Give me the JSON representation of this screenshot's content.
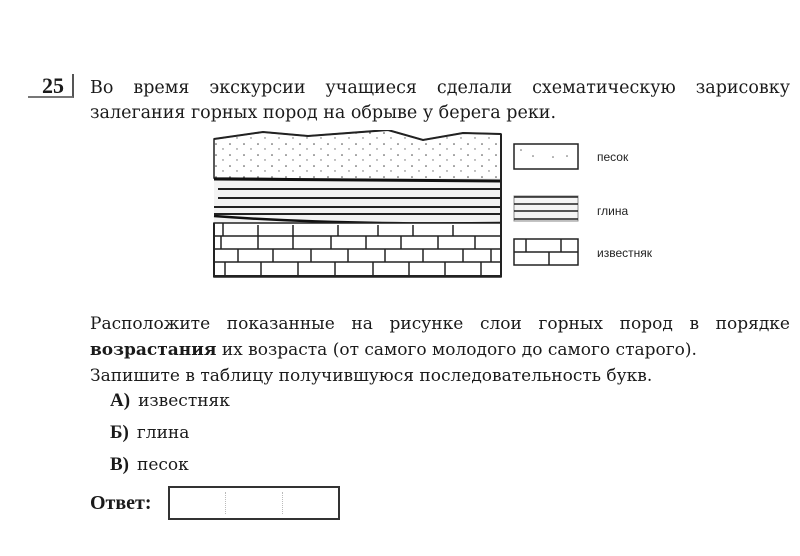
{
  "task": {
    "number": "25",
    "intro_line1": "Во время экскурсии учащиеся сделали схематическую зарисовку",
    "intro_line2": "залегания горных пород на обрыве у берега реки.",
    "instruction_line1": "Расположите показанные на рисунке слои горных пород в порядке",
    "instruction_bold": "возрастания",
    "instruction_line2_rest": " их возраста (от самого молодого до самого старого).",
    "instruction_line3": "Запишите в таблицу получившуюся последовательность букв."
  },
  "figure": {
    "layers_top_to_bottom": [
      "песок",
      "глина",
      "известняк"
    ]
  },
  "legend": [
    {
      "pattern": "dotted",
      "label": "песок"
    },
    {
      "pattern": "lines",
      "label": "глина"
    },
    {
      "pattern": "bricks",
      "label": "известняк"
    }
  ],
  "options": [
    {
      "letter": "А)",
      "text": "известняк"
    },
    {
      "letter": "Б)",
      "text": "глина"
    },
    {
      "letter": "В)",
      "text": "песок"
    }
  ],
  "answer": {
    "label": "Ответ:",
    "cells": [
      "",
      "",
      ""
    ]
  }
}
